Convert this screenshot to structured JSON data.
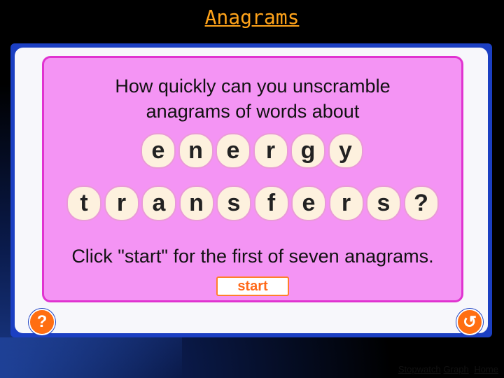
{
  "slide": {
    "title": "Anagrams"
  },
  "panel": {
    "intro_line1": "How quickly can you unscramble",
    "intro_line2": "anagrams of words about",
    "word1": [
      "e",
      "n",
      "e",
      "r",
      "g",
      "y"
    ],
    "word2": [
      "t",
      "r",
      "a",
      "n",
      "s",
      "f",
      "e",
      "r",
      "s",
      "?"
    ],
    "instruction": "Click \"start\" for the first of seven anagrams.",
    "start_label": "start"
  },
  "controls": {
    "help_icon": "question-mark",
    "help_glyph": "?",
    "back_icon": "undo-arrow",
    "back_glyph": "↺"
  },
  "footer": {
    "links": [
      "Stopwatch",
      "Graph",
      "Home"
    ]
  },
  "colors": {
    "title": "#ffa31a",
    "frame": "#1b3fc2",
    "panel": "#f494f4",
    "panel_border": "#e033d0",
    "tile": "#fdf1de",
    "accent": "#ff6e12"
  }
}
